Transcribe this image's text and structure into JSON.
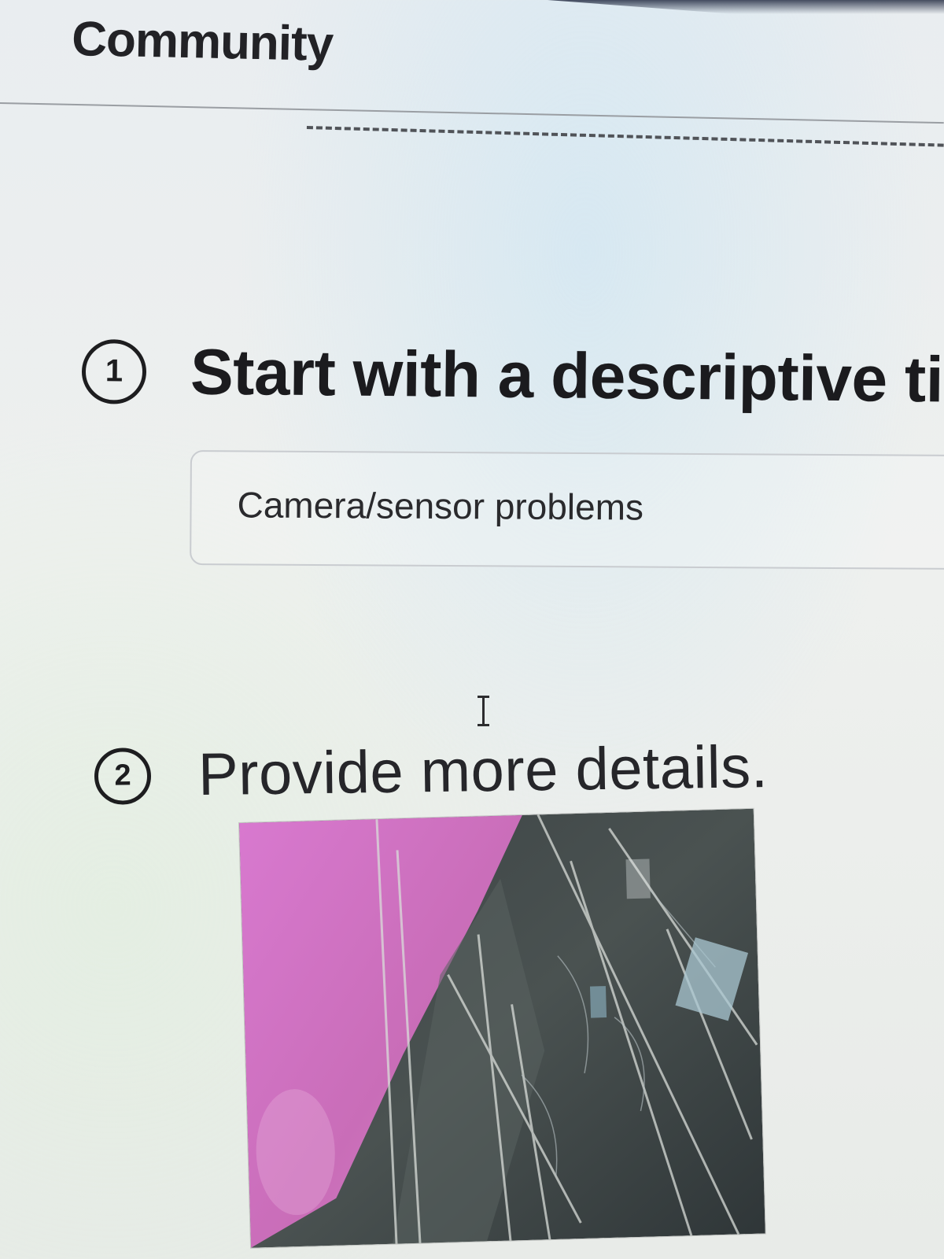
{
  "header": {
    "brand": "Community"
  },
  "form": {
    "step1": {
      "number": "1",
      "title": "Start with a descriptive title"
    },
    "title_input": {
      "value": "Camera/sensor problems"
    },
    "step2": {
      "number": "2",
      "title": "Provide more details."
    },
    "attachment": {
      "icon": "photo-attachment"
    }
  },
  "colors": {
    "text": "#1d1d1f",
    "input_border": "#c9ccd0",
    "photo_pink": "#d47ccc",
    "photo_dark": "#3d4548"
  }
}
